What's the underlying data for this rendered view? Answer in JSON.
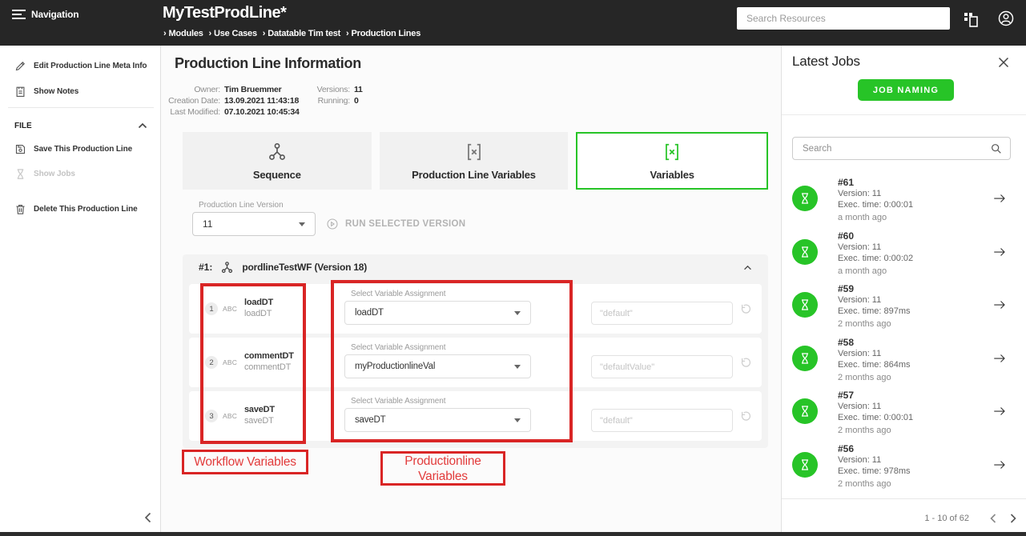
{
  "header": {
    "nav_label": "Navigation",
    "title": "MyTestProdLine*",
    "breadcrumb_sep": "›",
    "breadcrumbs": [
      "Modules",
      "Use Cases",
      "Datatable Tim test",
      "Production Lines"
    ],
    "search_placeholder": "Search Resources"
  },
  "sidebar": {
    "edit_meta": "Edit Production Line Meta Info",
    "show_notes": "Show Notes",
    "file_label": "FILE",
    "save": "Save This Production Line",
    "show_jobs": "Show Jobs",
    "delete": "Delete This Production Line"
  },
  "main": {
    "title": "Production Line Information",
    "meta": {
      "owner_label": "Owner:",
      "owner": "Tim Bruemmer",
      "creation_label": "Creation Date:",
      "creation": "13.09.2021 11:43:18",
      "modified_label": "Last Modified:",
      "modified": "07.10.2021 10:45:34",
      "versions_label": "Versions:",
      "versions": "11",
      "running_label": "Running:",
      "running": "0"
    },
    "tabs": [
      {
        "label": "Sequence"
      },
      {
        "label": "Production Line Variables"
      },
      {
        "label": "Variables"
      }
    ],
    "version_label": "Production Line Version",
    "version_value": "11",
    "run_label": "RUN SELECTED VERSION",
    "panel": {
      "index": "#1:",
      "name": "pordlineTestWF (Version 18)",
      "select_label": "Select Variable Assignment",
      "rows": [
        {
          "num": "1",
          "type": "ABC",
          "name": "loadDT",
          "subname": "loadDT",
          "select_value": "loadDT",
          "placeholder": "\"default\""
        },
        {
          "num": "2",
          "type": "ABC",
          "name": "commentDT",
          "subname": "commentDT",
          "select_value": "myProductionlineVal",
          "placeholder": "\"defaultValue\""
        },
        {
          "num": "3",
          "type": "ABC",
          "name": "saveDT",
          "subname": "saveDT",
          "select_value": "saveDT",
          "placeholder": "\"default\""
        }
      ]
    },
    "annotations": {
      "workflow": "Workflow Variables",
      "productionline": "Productionline Variables"
    }
  },
  "jobs": {
    "title": "Latest Jobs",
    "naming_button": "JOB NAMING",
    "search_placeholder": "Search",
    "items": [
      {
        "id": "#61",
        "version": "Version: 11",
        "exec": "Exec. time: 0:00:01",
        "age": "a month ago"
      },
      {
        "id": "#60",
        "version": "Version: 11",
        "exec": "Exec. time: 0:00:02",
        "age": "a month ago"
      },
      {
        "id": "#59",
        "version": "Version: 11",
        "exec": "Exec. time: 897ms",
        "age": "2 months ago"
      },
      {
        "id": "#58",
        "version": "Version: 11",
        "exec": "Exec. time: 864ms",
        "age": "2 months ago"
      },
      {
        "id": "#57",
        "version": "Version: 11",
        "exec": "Exec. time: 0:00:01",
        "age": "2 months ago"
      },
      {
        "id": "#56",
        "version": "Version: 11",
        "exec": "Exec. time: 978ms",
        "age": "2 months ago"
      }
    ],
    "pagination": "1 - 10 of 62"
  },
  "colors": {
    "accent_green": "#27c427",
    "annotation_red": "#d92525",
    "header_bg": "#262626"
  }
}
